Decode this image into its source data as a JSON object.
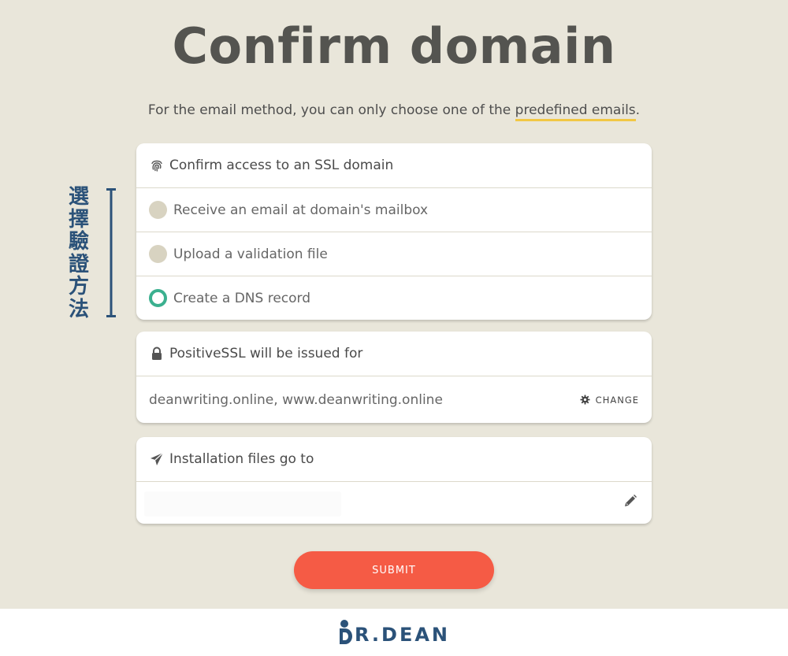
{
  "page": {
    "title": "Confirm domain",
    "subtitle_prefix": "For the email method, you can only choose one of the ",
    "subtitle_link": "predefined emails",
    "subtitle_suffix": "."
  },
  "validation": {
    "header_icon": "fingerprint-icon",
    "header": "Confirm access to an SSL domain",
    "options": [
      {
        "label": "Receive an email at domain's mailbox",
        "selected": false
      },
      {
        "label": "Upload a validation file",
        "selected": false
      },
      {
        "label": "Create a DNS record",
        "selected": true
      }
    ]
  },
  "ssl": {
    "header_icon": "lock-icon",
    "header": "PositiveSSL will be issued for",
    "domains": "deanwriting.online, www.deanwriting.online",
    "change_icon": "gear-icon",
    "change_label": "CHANGE"
  },
  "install": {
    "header_icon": "paper-plane-icon",
    "header": "Installation files go to",
    "path_value": "",
    "edit_icon": "pencil-icon"
  },
  "submit_label": "SUBMIT",
  "annotation": {
    "text": "選擇驗證方法",
    "color": "#2b5279"
  },
  "logo": {
    "text": "R.DEAN",
    "icon": "dr-dean-logo-icon"
  },
  "colors": {
    "background": "#e9e6da",
    "accent": "#f55b45",
    "radio_selected": "#3bb08f",
    "radio_idle": "#d8d3c1",
    "highlight": "#f2c744"
  }
}
